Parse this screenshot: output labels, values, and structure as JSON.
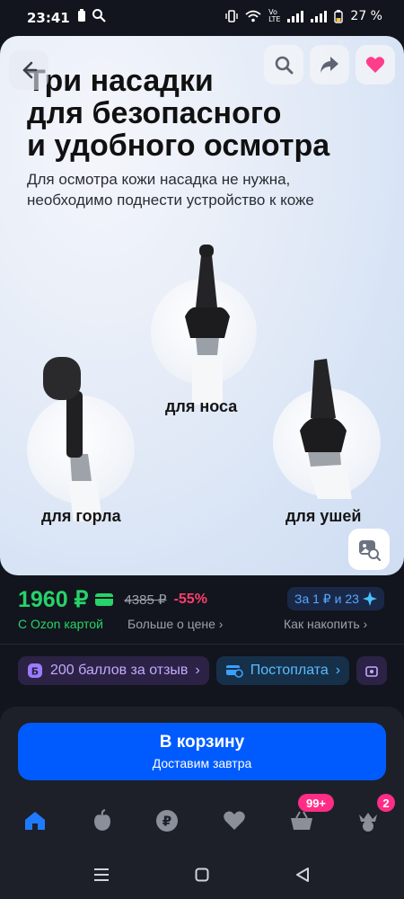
{
  "status": {
    "time": "23:41",
    "battery": "27 %"
  },
  "hero": {
    "title": [
      "Три насадки",
      "для безопасного",
      "и удобного осмотра"
    ],
    "subtitle": [
      "Для осмотра кожи насадка не нужна,",
      "необходимо поднести устройство к коже"
    ],
    "labels": {
      "nose": "для носа",
      "throat": "для горла",
      "ears": "для ушей"
    }
  },
  "price": {
    "current": "1960 ₽",
    "old": "4385 ₽",
    "discount": "-55%",
    "card_label": "С Ozon картой",
    "more_label": "Больше о цене",
    "accumulate_label": "Как накопить",
    "points_badge": "За 1 ₽ и 23"
  },
  "chips": {
    "review_bonus": "200 баллов за отзыв",
    "postpay": "Постоплата"
  },
  "cart": {
    "title": "В корзину",
    "subtitle": "Доставим завтра"
  },
  "tabbar": {
    "cart_badge": "99+",
    "profile_badge": "2"
  },
  "colors": {
    "accent": "#005bff",
    "price_green": "#27d36a",
    "discount_pink": "#ff3d6e",
    "badge": "#ff2d86"
  }
}
